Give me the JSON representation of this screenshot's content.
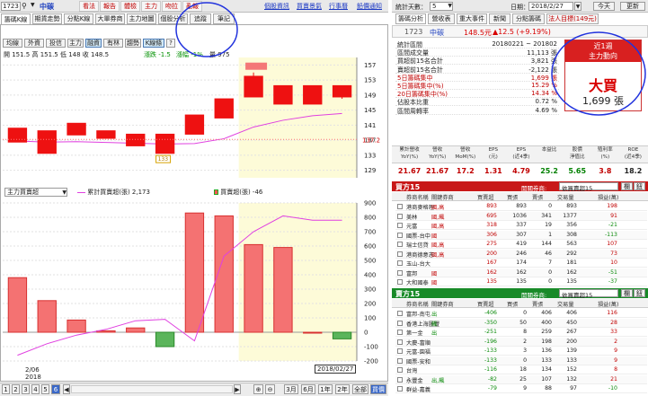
{
  "toolbar": {
    "code": "1723",
    "name": "中碳",
    "buttons": [
      "看法",
      "報告",
      "體檢",
      "主力",
      "吻拉",
      "亂報"
    ],
    "links": [
      "個股資訊",
      "買賣景氣",
      "行事曆",
      "鉛價通知"
    ]
  },
  "chart_tabs": [
    "籌碼K線",
    "期貨走勢",
    "分點K線",
    "大單券商",
    "主力地圖",
    "個股分析",
    "追蹤",
    "筆記"
  ],
  "chart_buttons": [
    "均線",
    "外資",
    "投信",
    "主力",
    "融資",
    "有林",
    "趨勢",
    "K線條",
    "?"
  ],
  "ohlc": {
    "text": "開 151.5  高 151.5  低 148  收 148.5",
    "change": "漲跌 -1.5",
    "change_pct": "漲幅 -1%",
    "volume": "量 975"
  },
  "price_chart_data": {
    "type": "candlestick",
    "ylim": [
      127,
      159
    ],
    "yticks": [
      129,
      133,
      137,
      141,
      145,
      149,
      153,
      157
    ],
    "candles": [
      {
        "o": 140.2,
        "c": 136.5,
        "h": 140.2,
        "l": 136.5
      },
      {
        "o": 139.5,
        "c": 133.5,
        "h": 139.5,
        "l": 133.5
      },
      {
        "o": 138.4,
        "c": 141.5,
        "h": 141.5,
        "l": 138.4
      },
      {
        "o": 139.5,
        "c": 137.5,
        "h": 139.5,
        "l": 137.5
      },
      {
        "o": 135.5,
        "c": 138.6,
        "h": 138.6,
        "l": 135.5
      },
      {
        "o": 133.5,
        "c": 138.6,
        "h": 138.6,
        "l": 133.5
      },
      {
        "o": 138.6,
        "c": 143.7,
        "h": 143.7,
        "l": 138.6
      },
      {
        "o": 142.9,
        "c": 148.0,
        "h": 148.0,
        "l": 142.9
      },
      {
        "o": 148.5,
        "c": 154.0,
        "h": 155.0,
        "l": 148.5
      },
      {
        "o": 146.6,
        "c": 151.5,
        "h": 151.5,
        "l": 146.6
      },
      {
        "o": 146.6,
        "c": 151.5,
        "h": 151.5,
        "l": 146.6
      },
      {
        "o": 151.5,
        "c": 148.5,
        "h": 151.5,
        "l": 148.0
      }
    ],
    "ma": [
      136.8,
      136.5,
      136.6,
      136.4,
      136.2,
      136.0,
      136.1,
      137.4,
      140.5,
      142.3,
      143.5,
      144.1
    ],
    "price_label": "137.2",
    "low_label": "133",
    "high_label": "155.0",
    "ma_label": "基本均線 144.10"
  },
  "flow_header": {
    "select_label": "主力買賣超",
    "legend1": "累計買賣超(張) 2,173",
    "legend2": "買賣超(張) -46"
  },
  "flow_chart_data": {
    "type": "bar",
    "ylim": [
      -200,
      900
    ],
    "yticks": [
      900,
      800,
      700,
      600,
      500,
      400,
      300,
      200,
      100,
      0,
      -100,
      -200
    ],
    "values": [
      380,
      220,
      85,
      10,
      30,
      -100,
      830,
      810,
      610,
      590,
      0,
      -46
    ],
    "cumulative": [
      -160,
      -80,
      -20,
      20,
      80,
      90,
      -60,
      530,
      700,
      810,
      780,
      780
    ]
  },
  "x_axis": {
    "date1": "2/06",
    "year": "2018",
    "last_date": "2018/02/27"
  },
  "bottom_bar": {
    "pages": [
      "1",
      "2",
      "3",
      "4",
      "5",
      "6"
    ],
    "range_buttons": [
      "3月",
      "6月",
      "1年",
      "2年",
      "全部",
      "買價"
    ]
  },
  "right_panel": {
    "stat_days_label": "統計天數：",
    "stat_days_value": "5",
    "date_label": "日期：",
    "date_value": "2018/2/27",
    "today_button": "今天",
    "update_button": "更新",
    "tabs": [
      "籌碼分析",
      "營收表",
      "重大事件",
      "新聞",
      "分點籌碼",
      "法人目標(149元)"
    ],
    "stock_code": "1723",
    "stock_name": "中碳",
    "stock_price": "148.5元",
    "stock_change": "▲12.5 (+9.19%)",
    "stats": [
      {
        "label": "統計區間",
        "value": "20180221 ~ 201802"
      },
      {
        "label": "區間成交量",
        "value": "11,113 張"
      },
      {
        "label": "買超前15名合計",
        "value": "3,821 張"
      },
      {
        "label": "賣超前15名合計",
        "value": "-2,122 張"
      },
      {
        "label": "5日籌碼集中",
        "value": "1,699 張"
      },
      {
        "label": "5日籌碼集中(%)",
        "value": "15.29 %"
      },
      {
        "label": "20日籌碼集中(%)",
        "value": "14.34 %"
      },
      {
        "label": "佔股本比重",
        "value": "0.72 %"
      },
      {
        "label": "區間周轉率",
        "value": "4.69 %"
      }
    ],
    "trend_title": "近1週\n主力動向",
    "trend_value": "大買",
    "trend_amount": "1,699 張",
    "fin_headers": [
      "累計營收\nYoY(%)",
      "營收\nYoY(%)",
      "營收\nMoM(%)",
      "EPS\n(元)",
      "EPS\n(近4季)",
      "本益比",
      "股價\n淨值比",
      "殖利率\n(%)",
      "ROE\n(近4季)"
    ],
    "fin_values": [
      "21.67",
      "21.67",
      "17.2",
      "1.31",
      "4.79",
      "25.2",
      "5.65",
      "3.8",
      "18.2"
    ],
    "buy_title": "買方15",
    "sell_title": "賣方15",
    "broker_label": "開關券商:",
    "broker_select": "依買賣超15",
    "table_headers": [
      "券商名稱",
      "關鍵券商",
      "買賣超",
      "買張",
      "賣張",
      "交易量",
      "損益(萬)"
    ],
    "buy_rows": [
      [
        "港商麥格理",
        "國,高",
        "893",
        "893",
        "0",
        "893",
        "198"
      ],
      [
        "美林",
        "國,飆",
        "695",
        "1036",
        "341",
        "1377",
        "91"
      ],
      [
        "元富",
        "國,高",
        "318",
        "337",
        "19",
        "356",
        "-21"
      ],
      [
        "國票-台中",
        "國",
        "306",
        "307",
        "1",
        "308",
        "-113"
      ],
      [
        "瑞士信貸",
        "國,高",
        "275",
        "419",
        "144",
        "563",
        "107"
      ],
      [
        "港商德意志",
        "國,高",
        "200",
        "246",
        "46",
        "292",
        "73"
      ],
      [
        "玉山-台大",
        "",
        "167",
        "174",
        "7",
        "181",
        "10"
      ],
      [
        "富邦",
        "國",
        "162",
        "162",
        "0",
        "162",
        "-51"
      ],
      [
        "大和國泰",
        "國",
        "135",
        "135",
        "0",
        "135",
        "-37"
      ]
    ],
    "sell_rows": [
      [
        "富邦-南屯",
        "出",
        "-406",
        "0",
        "406",
        "406",
        "116"
      ],
      [
        "香港上海匯豐",
        "飆",
        "-350",
        "50",
        "400",
        "450",
        "28"
      ],
      [
        "第一金",
        "出",
        "-251",
        "8",
        "259",
        "267",
        "33"
      ],
      [
        "大慶-富順",
        "",
        "-196",
        "2",
        "198",
        "200",
        "2"
      ],
      [
        "元富-園福",
        "",
        "-133",
        "3",
        "136",
        "139",
        "9"
      ],
      [
        "國票-安和",
        "",
        "-133",
        "0",
        "133",
        "133",
        "9"
      ],
      [
        "台灣",
        "",
        "-116",
        "18",
        "134",
        "152",
        "8"
      ],
      [
        "永豐金",
        "出,飆",
        "-82",
        "25",
        "107",
        "132",
        "21"
      ],
      [
        "群益-嘉義",
        "",
        "-79",
        "9",
        "88",
        "97",
        "-10"
      ]
    ]
  }
}
